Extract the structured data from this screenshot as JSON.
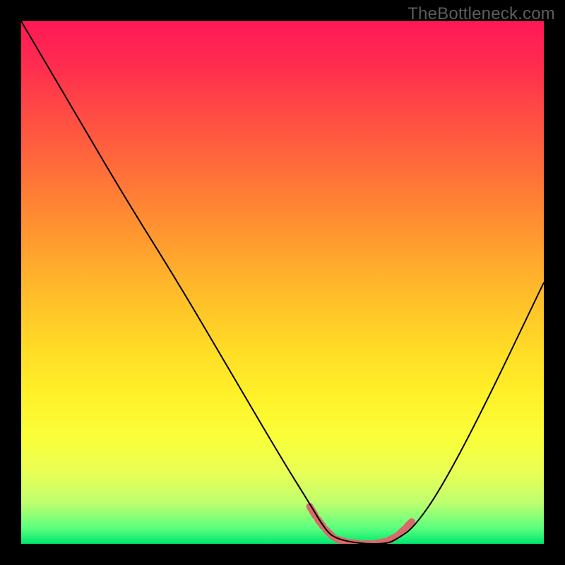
{
  "watermark": "TheBottleneck.com",
  "chart_data": {
    "type": "line",
    "title": "",
    "xlabel": "",
    "ylabel": "",
    "xlim": [
      0,
      100
    ],
    "ylim": [
      0,
      100
    ],
    "grid": false,
    "series": [
      {
        "name": "curve",
        "color": "#000000",
        "x": [
          0,
          10,
          20,
          30,
          40,
          50,
          55,
          58,
          60,
          65,
          70,
          72,
          75,
          80,
          88,
          100
        ],
        "values": [
          100,
          83,
          66,
          50,
          33,
          16,
          8,
          3,
          1,
          0,
          0,
          1,
          3,
          10,
          25,
          50
        ]
      }
    ],
    "accent_segments": {
      "color": "#d96a6a",
      "width": 10,
      "points": [
        {
          "x": 55.0,
          "y": 7.5
        },
        {
          "x": 56.5,
          "y": 5.0
        },
        {
          "x": 58.0,
          "y": 3.0
        },
        {
          "x": 60.0,
          "y": 1.0
        },
        {
          "x": 62.5,
          "y": 0.3
        },
        {
          "x": 65.0,
          "y": 0.0
        },
        {
          "x": 67.5,
          "y": 0.0
        },
        {
          "x": 70.0,
          "y": 0.5
        },
        {
          "x": 72.0,
          "y": 1.5
        },
        {
          "x": 73.5,
          "y": 3.0
        },
        {
          "x": 75.0,
          "y": 4.5
        }
      ]
    }
  }
}
